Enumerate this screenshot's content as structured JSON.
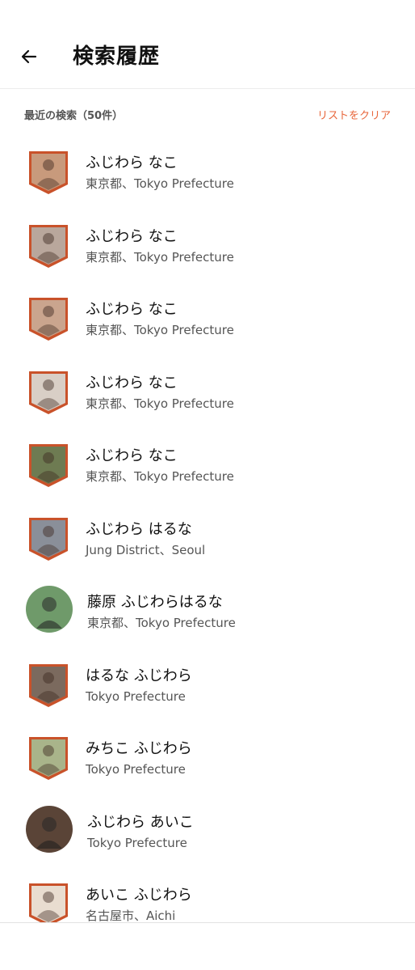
{
  "header": {
    "title": "検索履歴"
  },
  "section": {
    "title": "最近の検索（50件）",
    "clear_label": "リストをクリア"
  },
  "colors": {
    "accent": "#e8663b",
    "frame": "#c9522a"
  },
  "items": [
    {
      "name": "ふじわら なこ",
      "location": "東京都、Tokyo Prefecture",
      "avatar": "shield",
      "tone": "#c89a7c"
    },
    {
      "name": "ふじわら なこ",
      "location": "東京都、Tokyo Prefecture",
      "avatar": "shield",
      "tone": "#b9a79c"
    },
    {
      "name": "ふじわら なこ",
      "location": "東京都、Tokyo Prefecture",
      "avatar": "shield",
      "tone": "#caa58e"
    },
    {
      "name": "ふじわら なこ",
      "location": "東京都、Tokyo Prefecture",
      "avatar": "shield",
      "tone": "#d9cfc6"
    },
    {
      "name": "ふじわら  なこ",
      "location": "東京都、Tokyo Prefecture",
      "avatar": "shield",
      "tone": "#6e7b52"
    },
    {
      "name": "ふじわら はるな",
      "location": "Jung District、Seoul",
      "avatar": "shield",
      "tone": "#8a8f99"
    },
    {
      "name": "藤原 ふじわらはるな",
      "location": "東京都、Tokyo Prefecture",
      "avatar": "round",
      "tone": "#6f9a6a"
    },
    {
      "name": "はるな ふじわら",
      "location": "Tokyo Prefecture",
      "avatar": "shield",
      "tone": "#7b6a5e"
    },
    {
      "name": " みちこ ふじわら",
      "location": "Tokyo Prefecture",
      "avatar": "shield",
      "tone": "#a9b48a"
    },
    {
      "name": "ふじわら あいこ",
      "location": "Tokyo Prefecture",
      "avatar": "round",
      "tone": "#5a4437"
    },
    {
      "name": "あいこ ふじわら",
      "location": "名古屋市、Aichi",
      "avatar": "shield",
      "tone": "#e9ddd0"
    }
  ]
}
